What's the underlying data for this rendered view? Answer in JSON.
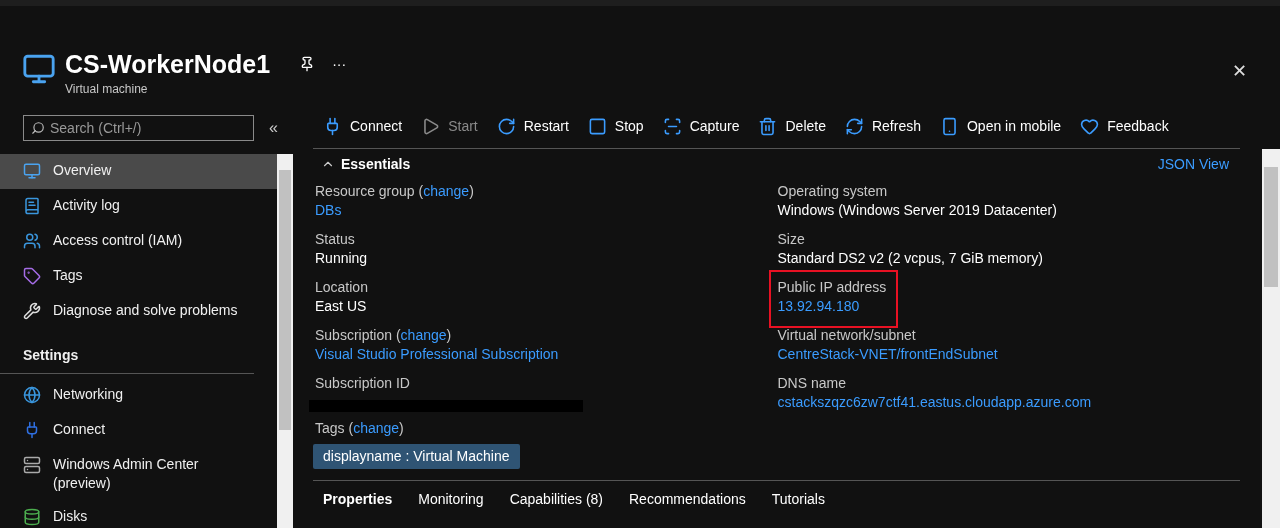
{
  "header": {
    "title": "CS-WorkerNode1",
    "subtitle": "Virtual machine",
    "more": "···",
    "close": "✕"
  },
  "sidebar": {
    "search": {
      "placeholder": "Search (Ctrl+/)"
    },
    "collapse": "«",
    "items": [
      {
        "label": "Overview",
        "selected": true
      },
      {
        "label": "Activity log",
        "selected": false
      },
      {
        "label": "Access control (IAM)",
        "selected": false
      },
      {
        "label": "Tags",
        "selected": false
      },
      {
        "label": "Diagnose and solve problems",
        "selected": false
      }
    ],
    "sections": [
      {
        "title": "Settings",
        "items": [
          {
            "label": "Networking",
            "selected": false
          },
          {
            "label": "Connect",
            "selected": false
          },
          {
            "label": "Windows Admin Center (preview)",
            "selected": false
          },
          {
            "label": "Disks",
            "selected": false
          }
        ]
      }
    ]
  },
  "toolbar": [
    {
      "label": "Connect",
      "disabled": false
    },
    {
      "label": "Start",
      "disabled": true
    },
    {
      "label": "Restart",
      "disabled": false
    },
    {
      "label": "Stop",
      "disabled": false
    },
    {
      "label": "Capture",
      "disabled": false
    },
    {
      "label": "Delete",
      "disabled": false
    },
    {
      "label": "Refresh",
      "disabled": false
    },
    {
      "label": "Open in mobile",
      "disabled": false
    },
    {
      "label": "Feedback",
      "disabled": false
    }
  ],
  "essentials": {
    "title": "Essentials",
    "expanded": true,
    "json_view": "JSON View",
    "left": [
      {
        "label": "Resource group",
        "open": "(",
        "change": "change",
        "close": ")",
        "value": "DBs",
        "kind": "link"
      },
      {
        "label": "Status",
        "value": "Running",
        "kind": "text"
      },
      {
        "label": "Location",
        "value": "East US",
        "kind": "text"
      },
      {
        "label": "Subscription",
        "open": "(",
        "change": "change",
        "close": ")",
        "value": "Visual Studio Professional Subscription",
        "kind": "link"
      },
      {
        "label": "Subscription ID",
        "kind": "redacted"
      }
    ],
    "right": [
      {
        "label": "Operating system",
        "value": "Windows (Windows Server 2019 Datacenter)",
        "kind": "text",
        "highlighted": false
      },
      {
        "label": "Size",
        "value": "Standard DS2 v2 (2 vcpus, 7 GiB memory)",
        "kind": "text",
        "highlighted": false
      },
      {
        "label": "Public IP address",
        "value": "13.92.94.180",
        "kind": "link",
        "highlighted": true
      },
      {
        "label": "Virtual network/subnet",
        "value": "CentreStack-VNET/frontEndSubnet",
        "kind": "link",
        "highlighted": false
      },
      {
        "label": "DNS name",
        "value": "cstackszqzc6zw7ctf41.eastus.cloudapp.azure.com",
        "kind": "link",
        "highlighted": false
      }
    ],
    "tags": {
      "label": "Tags",
      "open": "(",
      "change": "change",
      "close": ")",
      "items": [
        "displayname : Virtual Machine"
      ]
    }
  },
  "tabs": [
    {
      "label": "Properties",
      "selected": true
    },
    {
      "label": "Monitoring",
      "selected": false
    },
    {
      "label": "Capabilities (8)",
      "selected": false
    },
    {
      "label": "Recommendations",
      "selected": false
    },
    {
      "label": "Tutorials",
      "selected": false
    }
  ]
}
